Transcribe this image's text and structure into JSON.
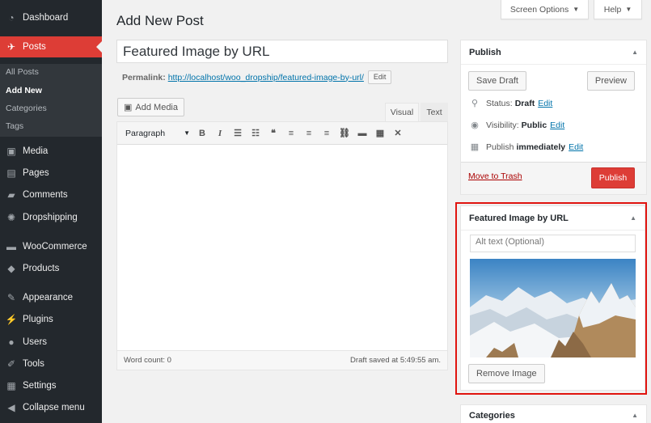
{
  "sidebar": {
    "items": [
      {
        "label": "Dashboard",
        "icon": "dashboard-icon"
      },
      {
        "label": "Posts",
        "icon": "pin-icon"
      },
      {
        "label": "Media",
        "icon": "media-icon"
      },
      {
        "label": "Pages",
        "icon": "pages-icon"
      },
      {
        "label": "Comments",
        "icon": "comments-icon"
      },
      {
        "label": "Dropshipping",
        "icon": "dropshipping-icon"
      },
      {
        "label": "WooCommerce",
        "icon": "woocommerce-icon"
      },
      {
        "label": "Products",
        "icon": "products-icon"
      },
      {
        "label": "Appearance",
        "icon": "appearance-icon"
      },
      {
        "label": "Plugins",
        "icon": "plugins-icon"
      },
      {
        "label": "Users",
        "icon": "users-icon"
      },
      {
        "label": "Tools",
        "icon": "tools-icon"
      },
      {
        "label": "Settings",
        "icon": "settings-icon"
      },
      {
        "label": "Collapse menu",
        "icon": "collapse-icon"
      }
    ],
    "submenu": [
      "All Posts",
      "Add New",
      "Categories",
      "Tags"
    ]
  },
  "top": {
    "screen_options": "Screen Options",
    "help": "Help"
  },
  "page": {
    "title": "Add New Post"
  },
  "post": {
    "title_value": "Featured Image by URL",
    "permalink_label": "Permalink:",
    "permalink_url": "http://localhost/woo_dropship/featured-image-by-url/",
    "edit_label": "Edit"
  },
  "editor": {
    "add_media": "Add Media",
    "tab_visual": "Visual",
    "tab_text": "Text",
    "format": "Paragraph",
    "word_count": "Word count: 0",
    "draft_saved": "Draft saved at 5:49:55 am."
  },
  "publish": {
    "title": "Publish",
    "save_draft": "Save Draft",
    "preview": "Preview",
    "status_label": "Status:",
    "status_value": "Draft",
    "visibility_label": "Visibility:",
    "visibility_value": "Public",
    "publish_label": "Publish",
    "publish_value": "immediately",
    "edit": "Edit",
    "move_to_trash": "Move to Trash",
    "publish_button": "Publish"
  },
  "featured_image": {
    "title": "Featured Image by URL",
    "alt_placeholder": "Alt text (Optional)",
    "remove_button": "Remove Image"
  },
  "categories": {
    "title": "Categories"
  },
  "colors": {
    "accent": "#dd3d36",
    "link": "#0073aa",
    "sidebar": "#23282d",
    "highlight": "#e0140f"
  }
}
